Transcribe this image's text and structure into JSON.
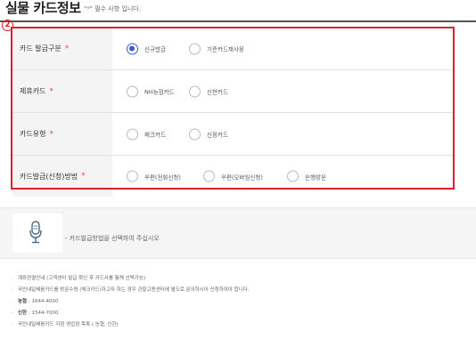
{
  "page": {
    "title": "실물 카드정보",
    "required_star": "*",
    "required_note_quote_open": "\"",
    "required_note_quote_close": "\"",
    "required_note": "필수 사항 입니다.",
    "step_marker": "2"
  },
  "form": {
    "required_mark": "*",
    "rows": [
      {
        "label": "카드 발급구분",
        "options": [
          {
            "label": "신규발급",
            "checked": true
          },
          {
            "label": "기존카드재사용",
            "checked": false
          }
        ]
      },
      {
        "label": "제휴카드",
        "options": [
          {
            "label": "NH농협카드",
            "checked": false
          },
          {
            "label": "신한카드",
            "checked": false
          }
        ]
      },
      {
        "label": "카드유형",
        "options": [
          {
            "label": "체크카드",
            "checked": false
          },
          {
            "label": "신용카드",
            "checked": false
          }
        ]
      },
      {
        "label": "카드발급(신청)방법",
        "options": [
          {
            "label": "우편(전화신청)",
            "checked": false
          },
          {
            "label": "우편(모바일신청)",
            "checked": false
          },
          {
            "label": "은행방문",
            "checked": false
          }
        ]
      }
    ]
  },
  "voice_guide": {
    "icon": "microphone-icon",
    "text": "- 카드발급방법을 선택하여 주십시오"
  },
  "info": {
    "items": [
      {
        "text": "계좌연결안내 (고객센터 발급 확인 후 카드사를 통해 선택가능)"
      },
      {
        "text": "국민내일배움카드를 방문수령 (체크카드)하고자 하는 경우 관할고용센터에 별도로 문의하시어 신청하여야 합니다."
      },
      {
        "name": "농협",
        "value": " : 1644-4000"
      },
      {
        "name": "신한",
        "value": " : 1544-7000"
      },
      {
        "text": "국민내일배움카드 지점 영업점 목록 ( 농협, 신한)"
      }
    ]
  },
  "colors": {
    "accent_blue": "#3b5bd9",
    "required_orange": "#e8503a",
    "highlight_red": "#e21b2e"
  }
}
